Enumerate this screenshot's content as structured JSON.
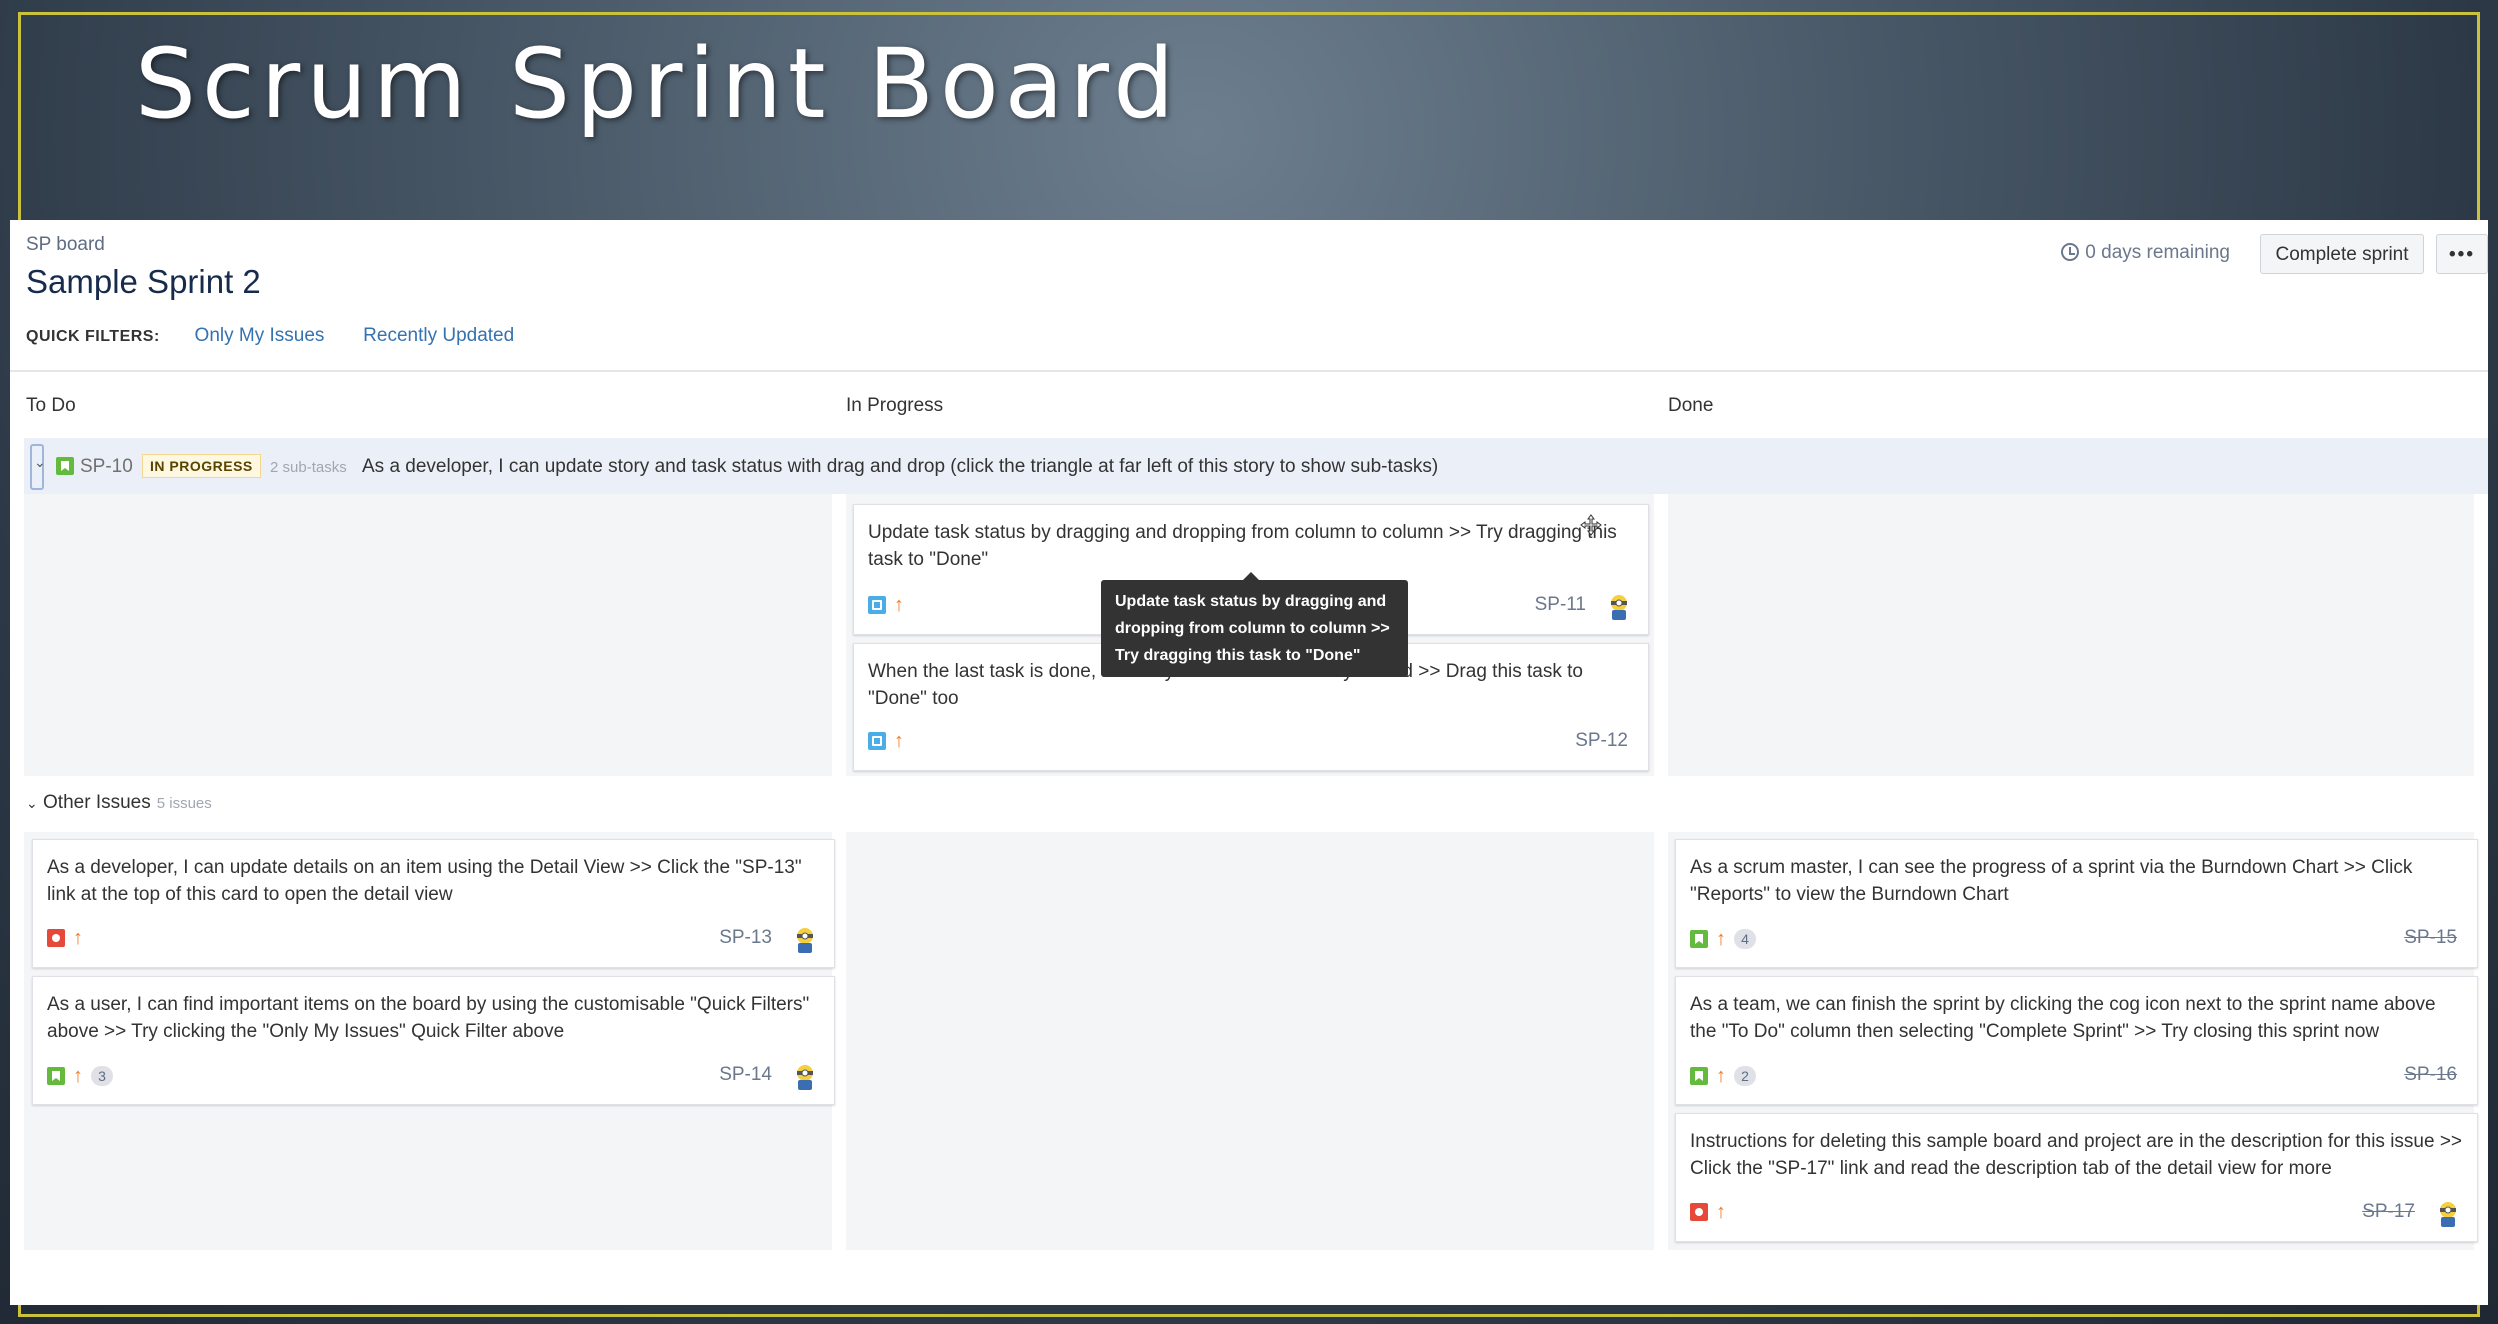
{
  "slide": {
    "title": "Scrum Sprint Board"
  },
  "header": {
    "breadcrumb": "SP board",
    "sprint_name": "Sample Sprint 2",
    "days_remaining": "0 days remaining",
    "complete_sprint_label": "Complete sprint",
    "more_label": "•••"
  },
  "quick_filters": {
    "label": "QUICK FILTERS:",
    "items": [
      "Only My Issues",
      "Recently Updated"
    ]
  },
  "columns": [
    "To Do",
    "In Progress",
    "Done"
  ],
  "story": {
    "key": "SP-10",
    "status": "IN PROGRESS",
    "subtasks": "2 sub-tasks",
    "summary": "As a developer, I can update story and task status with drag and drop (click the triangle at far left of this story to show sub-tasks)"
  },
  "subtask_cards": [
    {
      "text": "Update task status by dragging and dropping from column to column >> Try dragging this task to \"Done\"",
      "key": "SP-11",
      "type": "task",
      "priority": "high"
    },
    {
      "text": "When the last task is done, the story can be automatically closed >> Drag this task to \"Done\" too",
      "key": "SP-12",
      "type": "task",
      "priority": "high"
    }
  ],
  "tooltip": "Update task status by dragging and dropping from column to column >> Try dragging this task to \"Done\"",
  "other_issues": {
    "label": "Other Issues",
    "count": "5 issues"
  },
  "todo_cards": [
    {
      "text": "As a developer, I can update details on an item using the Detail View >> Click the \"SP-13\" link at the top of this card to open the detail view",
      "key": "SP-13",
      "type": "bug",
      "priority": "high",
      "badge": ""
    },
    {
      "text": "As a user, I can find important items on the board by using the customisable \"Quick Filters\" above >> Try clicking the \"Only My Issues\" Quick Filter above",
      "key": "SP-14",
      "type": "story",
      "priority": "high",
      "badge": "3"
    }
  ],
  "done_cards": [
    {
      "text": "As a scrum master, I can see the progress of a sprint via the Burndown Chart >> Click \"Reports\" to view the Burndown Chart",
      "key": "SP-15",
      "type": "story",
      "priority": "high",
      "badge": "4"
    },
    {
      "text": "As a team, we can finish the sprint by clicking the cog icon next to the sprint name above the \"To Do\" column then selecting \"Complete Sprint\" >> Try closing this sprint now",
      "key": "SP-16",
      "type": "story",
      "priority": "high",
      "badge": "2"
    },
    {
      "text": "Instructions for deleting this sample board and project are in the description for this issue >> Click the \"SP-17\" link and read the description tab of the detail view for more",
      "key": "SP-17",
      "type": "bug",
      "priority": "high",
      "badge": ""
    }
  ],
  "colors": {
    "story": "#63ba3c",
    "bug": "#e5493a",
    "task": "#4bade8",
    "priority_high": "#f07b28",
    "link": "#3572b0",
    "slide_frame": "#c9c23a"
  }
}
